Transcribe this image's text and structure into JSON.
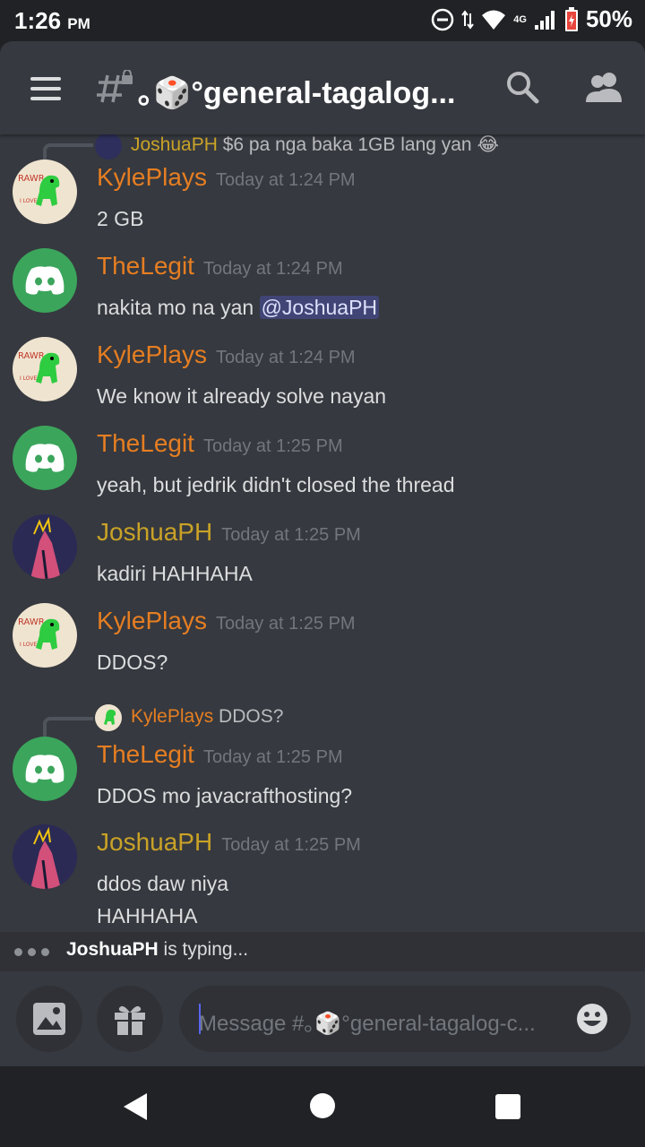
{
  "status_bar": {
    "time": "1:26",
    "ampm": "PM",
    "network": "4G",
    "battery": "50%"
  },
  "header": {
    "channel_name": "｡🎲°general-tagalog...",
    "icons": [
      "menu-icon",
      "locked-hash-icon",
      "search-icon",
      "members-icon"
    ]
  },
  "messages": [
    {
      "type": "reply-preview",
      "author": "JoshuaPH",
      "text": "$6 pa nga baka 1GB lang yan 😂"
    },
    {
      "author": "KylePlays",
      "timestamp": "Today at 1:24 PM",
      "text": "2 GB"
    },
    {
      "author": "TheLegit",
      "timestamp": "Today at 1:24 PM",
      "text": "nakita mo na yan ",
      "mention": "@JoshuaPH"
    },
    {
      "author": "KylePlays",
      "timestamp": "Today at 1:24 PM",
      "text": "We know it already solve nayan"
    },
    {
      "author": "TheLegit",
      "timestamp": "Today at 1:25 PM",
      "text": "yeah, but jedrik didn't closed the thread"
    },
    {
      "author": "JoshuaPH",
      "timestamp": "Today at 1:25 PM",
      "text": "kadiri HAHHAHA"
    },
    {
      "author": "KylePlays",
      "timestamp": "Today at 1:25 PM",
      "text": "DDOS?"
    },
    {
      "author": "TheLegit",
      "timestamp": "Today at 1:25 PM",
      "text": "DDOS mo javacrafthosting?",
      "reply_to": {
        "author": "KylePlays",
        "text": "DDOS?"
      }
    },
    {
      "author": "JoshuaPH",
      "timestamp": "Today at 1:25 PM",
      "text": "ddos daw niya",
      "text2": "HAHHAHA"
    }
  ],
  "typing": {
    "name": "JoshuaPH",
    "rest": " is typing..."
  },
  "composer": {
    "placeholder": "Message #｡🎲°general-tagalog-c..."
  },
  "colors": {
    "background": "#36393f",
    "kyle": "#e67e22",
    "joshua": "#c9a227",
    "discord_green": "#3ba55c",
    "mention_bg": "#4b4f8a"
  }
}
